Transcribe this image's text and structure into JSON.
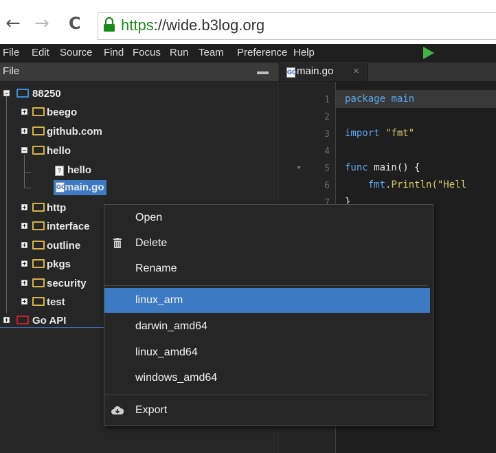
{
  "browser": {
    "back_glyph": "←",
    "forward_glyph": "→",
    "reload_glyph": "C",
    "url_protocol": "https",
    "url_rest": "://wide.b3log.org"
  },
  "menubar": {
    "items": [
      "File",
      "Edit",
      "Source",
      "Find",
      "Focus",
      "Run",
      "Team",
      "Preference",
      "Help"
    ]
  },
  "file_panel": {
    "title": "File"
  },
  "tree": {
    "root": "88250",
    "items": [
      "beego",
      "github.com",
      "hello",
      "hello",
      "main.go",
      "http",
      "interface",
      "outline",
      "pkgs",
      "security",
      "test"
    ],
    "go_api": "Go API"
  },
  "editor": {
    "tab_label": "main.go",
    "tab_close": "×",
    "file_icon_text": "GO",
    "line_numbers": [
      "1",
      "2",
      "3",
      "4",
      "5",
      "6",
      "7"
    ],
    "code": {
      "l1_kw": "package",
      "l1_rest": " main",
      "l3_kw": "import",
      "l3_str": "\"fmt\"",
      "l5_kw": "func",
      "l5_rest": " main() {",
      "l6_pkg": "    fmt",
      "l6_rest": ".Println(\"Hell",
      "l7": "}"
    }
  },
  "context_menu": {
    "open": "Open",
    "delete": "Delete",
    "rename": "Rename",
    "linux_arm": "linux_arm",
    "darwin_amd64": "darwin_amd64",
    "linux_amd64": "linux_amd64",
    "windows_amd64": "windows_amd64",
    "export": "Export"
  },
  "colors": {
    "accent": "#3d7ac4",
    "run": "#43b345",
    "folder": "#d6b34a"
  }
}
